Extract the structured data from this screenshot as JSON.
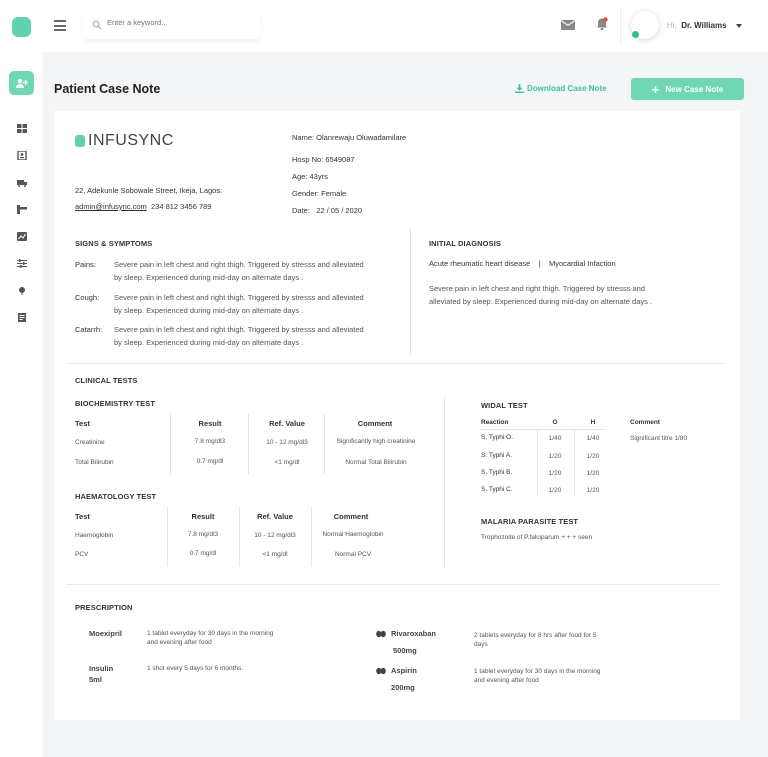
{
  "header": {
    "search_placeholder": "Enter a keyword...",
    "greeting": "Hi,",
    "user_name": "Dr. Williams"
  },
  "page": {
    "title": "Patient Case Note",
    "download_label": "Download Case Note",
    "new_label": "New Case Note"
  },
  "clinic": {
    "logo_text": "INFUSYNC",
    "address": "22, Adekunle Sobowale Street, Ikeja, Lagos.",
    "email": "admin@infusync.com",
    "phone": "234 812 3456 789"
  },
  "patient": {
    "name": "Name: Olanrewaju Oluwadamilare",
    "hosp": "Hosp No: 6549087",
    "age": "Age: 43yrs",
    "gender": "Gender: Female",
    "date_label": "Date:",
    "date_value": "22 / 05 / 2020"
  },
  "signs": {
    "title": "SIGNS & SYMPTOMS",
    "items": [
      {
        "label": "Pains:",
        "line1": "Severe pain in left chest and right thigh. Triggered by stresss and alleviated",
        "line2": "by sleep. Experienced during mid-day on alternate days ."
      },
      {
        "label": "Cough:",
        "line1": "Severe pain in left chest and right thigh. Triggered by stresss and alleviated",
        "line2": "by sleep. Experienced during mid-day on alternate days ."
      },
      {
        "label": "Catarrh:",
        "line1": "Severe pain in left chest and right thigh. Triggered by stresss and alleviated",
        "line2": "by sleep. Experienced during mid-day on alternate days ."
      }
    ]
  },
  "diagnosis": {
    "title": "INITIAL DIAGNOSIS",
    "d1": "Acute rheumatic heart disease",
    "sep": "|",
    "d2": "Myocardial Infaction",
    "line1": "Severe pain in left chest and right thigh. Triggered by stresss and",
    "line2": "alleviated by sleep. Experienced during mid-day on alternate days ."
  },
  "clinical": {
    "title": "CLINICAL TESTS",
    "biochem": {
      "title": "BIOCHEMISTRY TEST",
      "headers": [
        "Test",
        "Result",
        "Ref. Value",
        "Comment"
      ],
      "rows": [
        [
          "Creatinine",
          "7.8 mg/dl3",
          "10 - 12 mg/dl3",
          "Significantly high creatinine"
        ],
        [
          "Total Bilirubin",
          "0.7 mg/dl",
          "<1 mg/dl",
          "Normal Total Bilirubin"
        ]
      ]
    },
    "haem": {
      "title": "HAEMATOLOGY TEST",
      "headers": [
        "Test",
        "Result",
        "Ref. Value",
        "Comment"
      ],
      "rows": [
        [
          "Haemoglobin",
          "7.8 mg/dl3",
          "10 - 12 mg/dl3",
          "Normal Haemoglobin"
        ],
        [
          "PCV",
          "0.7 mg/dl",
          "<1 mg/dl",
          "Normal PCV"
        ]
      ]
    },
    "widal": {
      "title": "WIDAL TEST",
      "headers": [
        "Reaction",
        "O",
        "H"
      ],
      "rows": [
        [
          "S. Typhi O.",
          "1/40",
          "1/40"
        ],
        [
          "S. Typhi A.",
          "1/20",
          "1/20"
        ],
        [
          "S. Typhi B.",
          "1/20",
          "1/20"
        ],
        [
          "S. Typhi C.",
          "1/20",
          "1/20"
        ]
      ],
      "comment_header": "Comment",
      "comment": "Significant titre 1/80"
    },
    "malaria": {
      "title": "MALARIA PARASITE TEST",
      "result": "Trophozoite of P.falciparum + + + seen"
    }
  },
  "prescription": {
    "title": "PRESCRIPTION",
    "items": [
      {
        "name": "Moexipril",
        "name2": "",
        "instr1": "1 tablet everyday for 30 days in the morning",
        "instr2": "and evening after food"
      },
      {
        "name": "Rivaroxaban",
        "name2": "500mg",
        "instr1": "2 tablets everyday for 8 hrs after food for 5",
        "instr2": "days"
      },
      {
        "name": "Insulin",
        "name2": "5ml",
        "instr1": "1 shot every 5 days for 6 months.",
        "instr2": ""
      },
      {
        "name": "Aspirin",
        "name2": "200mg",
        "instr1": "1 tablet everyday for 30 days in the morning",
        "instr2": "and evening after food"
      }
    ]
  }
}
